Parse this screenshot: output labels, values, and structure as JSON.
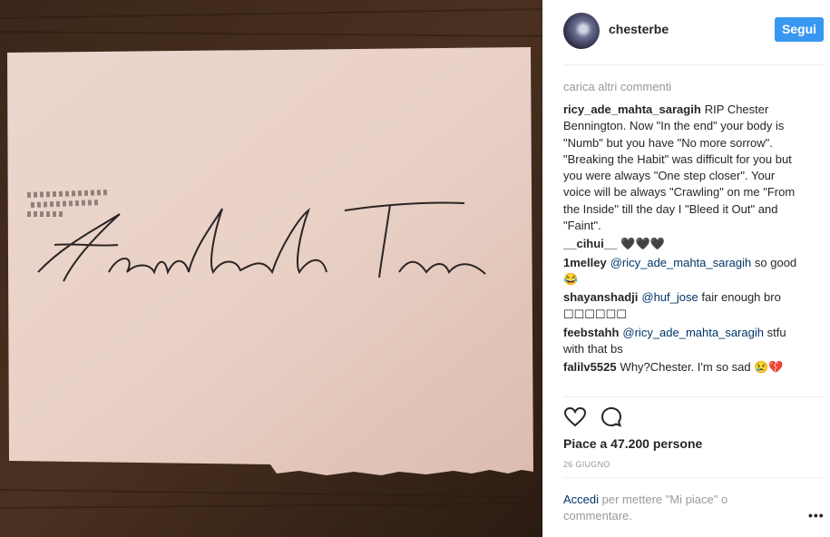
{
  "post": {
    "image_text": "Heimlich Treu",
    "username": "chesterbe",
    "follow_label": "Segui",
    "load_more": "carica altri commenti",
    "comments": [
      {
        "user": "ricy_ade_mahta_saragih",
        "text": "RIP Chester Bennington. Now \"In the end\" your body is \"Numb\" but you have \"No more sorrow\". \"Breaking the Habit\" was difficult for you but you were always \"One step closer\". Your voice will be always \"Crawling\" on me \"From the Inside\" till the day I \"Bleed it Out\" and \"Faint\"."
      },
      {
        "user": "__cihui__",
        "text": "🖤🖤🖤"
      },
      {
        "user": "1melley",
        "mention": "@ricy_ade_mahta_saragih",
        "text": "so good 😂"
      },
      {
        "user": "shayanshadji",
        "mention": "@huf_jose",
        "text": "fair enough bro ☐☐☐☐☐☐"
      },
      {
        "user": "feebstahh",
        "mention": "@ricy_ade_mahta_saragih",
        "text": "stfu with that bs"
      },
      {
        "user": "falilv5525",
        "text": "Why?Chester. I'm so sad 😢💔"
      }
    ],
    "likes": "Piace a 47.200 persone",
    "date": "26 GIUGNO",
    "login_link": "Accedi",
    "login_text": "per mettere \"Mi piace\" o commentare.",
    "more": "•••",
    "icons": {
      "like": "heart-icon",
      "comment": "comment-icon",
      "more": "more-options-icon"
    }
  }
}
